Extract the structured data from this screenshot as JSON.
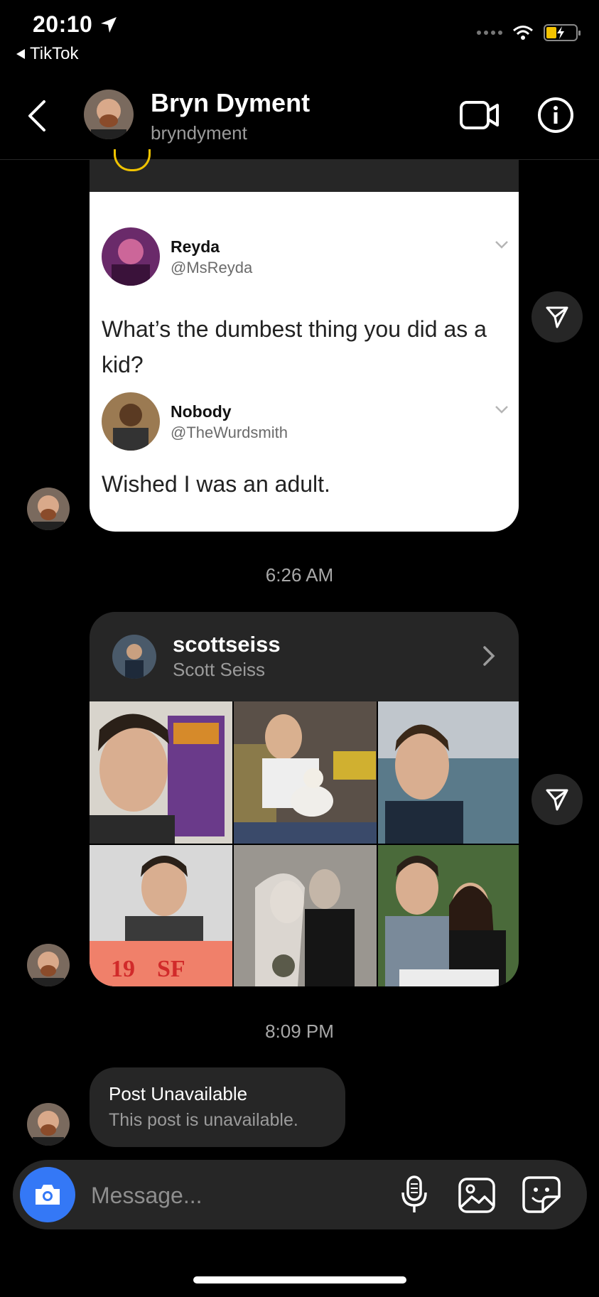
{
  "status_bar": {
    "time": "20:10",
    "back_app": "TikTok"
  },
  "header": {
    "name": "Bryn Dyment",
    "username": "bryndyment"
  },
  "tweet": {
    "author1": {
      "name": "Reyda",
      "handle": "@MsReyda"
    },
    "text1": "What’s the dumbest thing you did as a kid?",
    "author2": {
      "name": "Nobody",
      "handle": "@TheWurdsmith"
    },
    "text2": "Wished I was an adult."
  },
  "timestamps": {
    "first": "6:26 AM",
    "second": "8:09 PM"
  },
  "profile_share": {
    "username": "scottseiss",
    "full_name": "Scott Seiss"
  },
  "unavailable": {
    "title": "Post Unavailable",
    "subtitle": "This post is unavailable."
  },
  "composer": {
    "placeholder": "Message..."
  },
  "colors": {
    "accent": "#3478f6",
    "bubble": "#262626",
    "battery": "#f5c400"
  }
}
